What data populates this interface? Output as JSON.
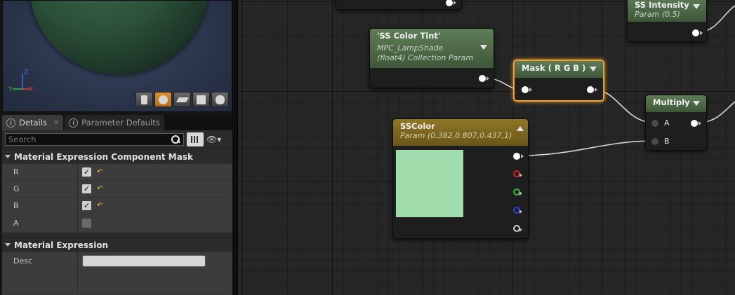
{
  "details_panel": {
    "tabs": [
      {
        "label": "Details",
        "active": true
      },
      {
        "label": "Parameter Defaults",
        "active": false
      }
    ],
    "search": {
      "placeholder": "Search"
    },
    "sections": [
      {
        "title": "Material Expression Component Mask",
        "rows": [
          {
            "name": "R",
            "checked": true
          },
          {
            "name": "G",
            "checked": true
          },
          {
            "name": "B",
            "checked": true
          },
          {
            "name": "A",
            "checked": false
          }
        ]
      },
      {
        "title": "Material Expression",
        "rows": [
          {
            "name": "Desc",
            "value": ""
          }
        ]
      }
    ]
  },
  "graph": {
    "nodes": {
      "ss_intensity": {
        "title": "SS Intensity",
        "subtitle": "Param (0.5)"
      },
      "ss_color_tint": {
        "title": "'SS Color Tint'",
        "subtitle1": "MPC_LampShade",
        "subtitle2": "(float4) Collection Param"
      },
      "mask": {
        "title": "Mask ( R G B )"
      },
      "multiply": {
        "title": "Multiply",
        "input_a": "A",
        "input_b": "B"
      },
      "ss_color": {
        "title": "SSColor",
        "subtitle": "Param (0.382,0.807,0.437,1)",
        "swatch_color": "#a0dcac"
      }
    }
  },
  "colors": {
    "accent_selected": "#f0a02a",
    "param_header": "#5f7d58",
    "vector_param_header": "#8f7628"
  }
}
